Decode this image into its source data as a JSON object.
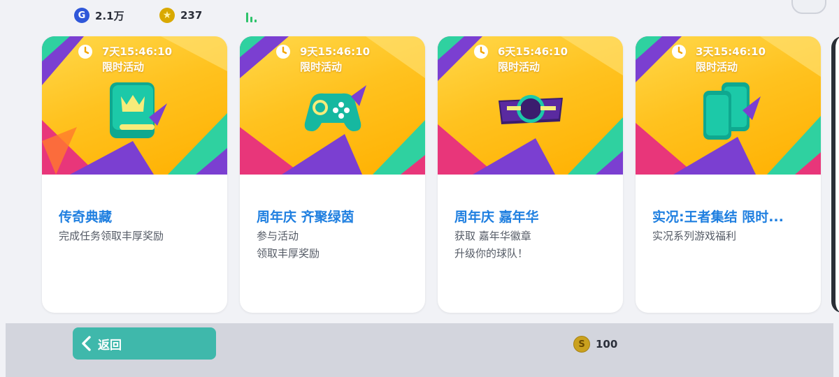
{
  "topbar": {
    "gcoin_value": "2.1万",
    "gcoin_icon_letter": "G",
    "star_value": "237",
    "star_icon": "★"
  },
  "cards": [
    {
      "timer": "7天15:46:10",
      "tag": "限时活动",
      "icon": "crown-book-icon",
      "title": "传奇典藏",
      "desc": [
        "完成任务领取丰厚奖励"
      ]
    },
    {
      "timer": "9天15:46:10",
      "tag": "限时活动",
      "icon": "gamepad-icon",
      "title": "周年庆 齐聚绿茵",
      "desc": [
        "参与活动",
        "领取丰厚奖励"
      ]
    },
    {
      "timer": "6天15:46:10",
      "tag": "限时活动",
      "icon": "anniversary-badge-icon",
      "title": "周年庆 嘉年华",
      "desc": [
        "获取 嘉年华徽章",
        "升级你的球队！"
      ]
    },
    {
      "timer": "3天15:46:10",
      "tag": "限时活动",
      "icon": "phones-icon",
      "title": "实况:王者集结 限时...",
      "desc": [
        "实况系列游戏福利"
      ]
    }
  ],
  "bottom": {
    "back_label": "返回",
    "coin_letter": "S",
    "coin_value": "100"
  },
  "colors": {
    "title_blue": "#1f7fe0",
    "back_button": "#3fb8ab",
    "banner_yellow": "#ffc21f"
  }
}
